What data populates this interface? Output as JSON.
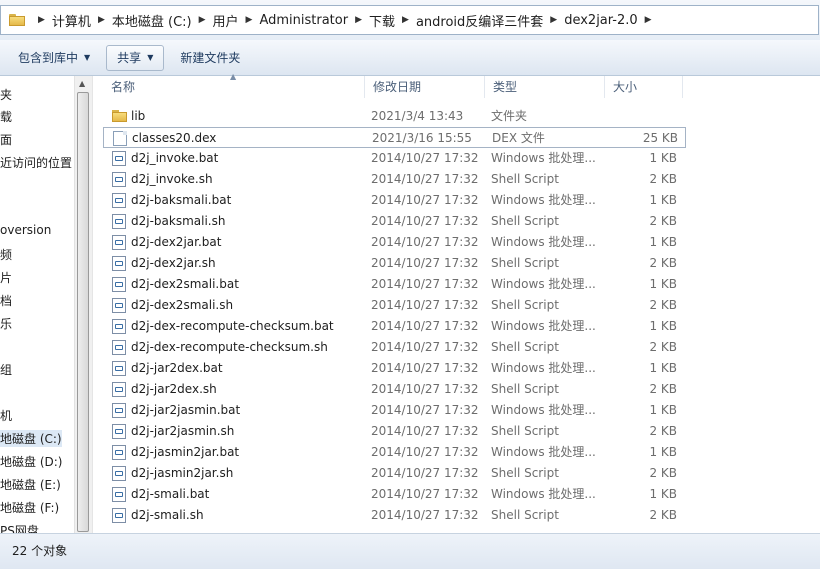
{
  "address_bar": {
    "crumbs": [
      "计算机",
      "本地磁盘 (C:)",
      "用户",
      "Administrator",
      "下载",
      "android反编译三件套",
      "dex2jar-2.0"
    ]
  },
  "toolbar": {
    "include_library": "包含到库中",
    "share": "共享",
    "new_folder": "新建文件夹"
  },
  "nav_pane": {
    "items": [
      "夹",
      "载",
      "面",
      "近访问的位置",
      "oversion",
      "频",
      "片",
      "档",
      "乐",
      "组",
      "机",
      "地磁盘 (C:)",
      "地磁盘 (D:)",
      "地磁盘 (E:)",
      "地磁盘 (F:)",
      "PS网盘"
    ]
  },
  "columns": {
    "name": "名称",
    "date": "修改日期",
    "type": "类型",
    "size": "大小"
  },
  "files": [
    {
      "name": "lib",
      "date": "2021/3/4 13:43",
      "type": "文件夹",
      "size": "",
      "icon": "folder-icon"
    },
    {
      "name": "classes20.dex",
      "date": "2021/3/16 15:55",
      "type": "DEX 文件",
      "size": "25 KB",
      "icon": "document-icon"
    },
    {
      "name": "d2j_invoke.bat",
      "date": "2014/10/27 17:32",
      "type": "Windows 批处理...",
      "size": "1 KB",
      "icon": "script-icon"
    },
    {
      "name": "d2j_invoke.sh",
      "date": "2014/10/27 17:32",
      "type": "Shell Script",
      "size": "2 KB",
      "icon": "script-icon"
    },
    {
      "name": "d2j-baksmali.bat",
      "date": "2014/10/27 17:32",
      "type": "Windows 批处理...",
      "size": "1 KB",
      "icon": "script-icon"
    },
    {
      "name": "d2j-baksmali.sh",
      "date": "2014/10/27 17:32",
      "type": "Shell Script",
      "size": "2 KB",
      "icon": "script-icon"
    },
    {
      "name": "d2j-dex2jar.bat",
      "date": "2014/10/27 17:32",
      "type": "Windows 批处理...",
      "size": "1 KB",
      "icon": "script-icon"
    },
    {
      "name": "d2j-dex2jar.sh",
      "date": "2014/10/27 17:32",
      "type": "Shell Script",
      "size": "2 KB",
      "icon": "script-icon"
    },
    {
      "name": "d2j-dex2smali.bat",
      "date": "2014/10/27 17:32",
      "type": "Windows 批处理...",
      "size": "1 KB",
      "icon": "script-icon"
    },
    {
      "name": "d2j-dex2smali.sh",
      "date": "2014/10/27 17:32",
      "type": "Shell Script",
      "size": "2 KB",
      "icon": "script-icon"
    },
    {
      "name": "d2j-dex-recompute-checksum.bat",
      "date": "2014/10/27 17:32",
      "type": "Windows 批处理...",
      "size": "1 KB",
      "icon": "script-icon"
    },
    {
      "name": "d2j-dex-recompute-checksum.sh",
      "date": "2014/10/27 17:32",
      "type": "Shell Script",
      "size": "2 KB",
      "icon": "script-icon"
    },
    {
      "name": "d2j-jar2dex.bat",
      "date": "2014/10/27 17:32",
      "type": "Windows 批处理...",
      "size": "1 KB",
      "icon": "script-icon"
    },
    {
      "name": "d2j-jar2dex.sh",
      "date": "2014/10/27 17:32",
      "type": "Shell Script",
      "size": "2 KB",
      "icon": "script-icon"
    },
    {
      "name": "d2j-jar2jasmin.bat",
      "date": "2014/10/27 17:32",
      "type": "Windows 批处理...",
      "size": "1 KB",
      "icon": "script-icon"
    },
    {
      "name": "d2j-jar2jasmin.sh",
      "date": "2014/10/27 17:32",
      "type": "Shell Script",
      "size": "2 KB",
      "icon": "script-icon"
    },
    {
      "name": "d2j-jasmin2jar.bat",
      "date": "2014/10/27 17:32",
      "type": "Windows 批处理...",
      "size": "1 KB",
      "icon": "script-icon"
    },
    {
      "name": "d2j-jasmin2jar.sh",
      "date": "2014/10/27 17:32",
      "type": "Shell Script",
      "size": "2 KB",
      "icon": "script-icon"
    },
    {
      "name": "d2j-smali.bat",
      "date": "2014/10/27 17:32",
      "type": "Windows 批处理...",
      "size": "1 KB",
      "icon": "script-icon"
    },
    {
      "name": "d2j-smali.sh",
      "date": "2014/10/27 17:32",
      "type": "Shell Script",
      "size": "2 KB",
      "icon": "script-icon"
    }
  ],
  "status_bar": {
    "count": "22 个对象"
  }
}
